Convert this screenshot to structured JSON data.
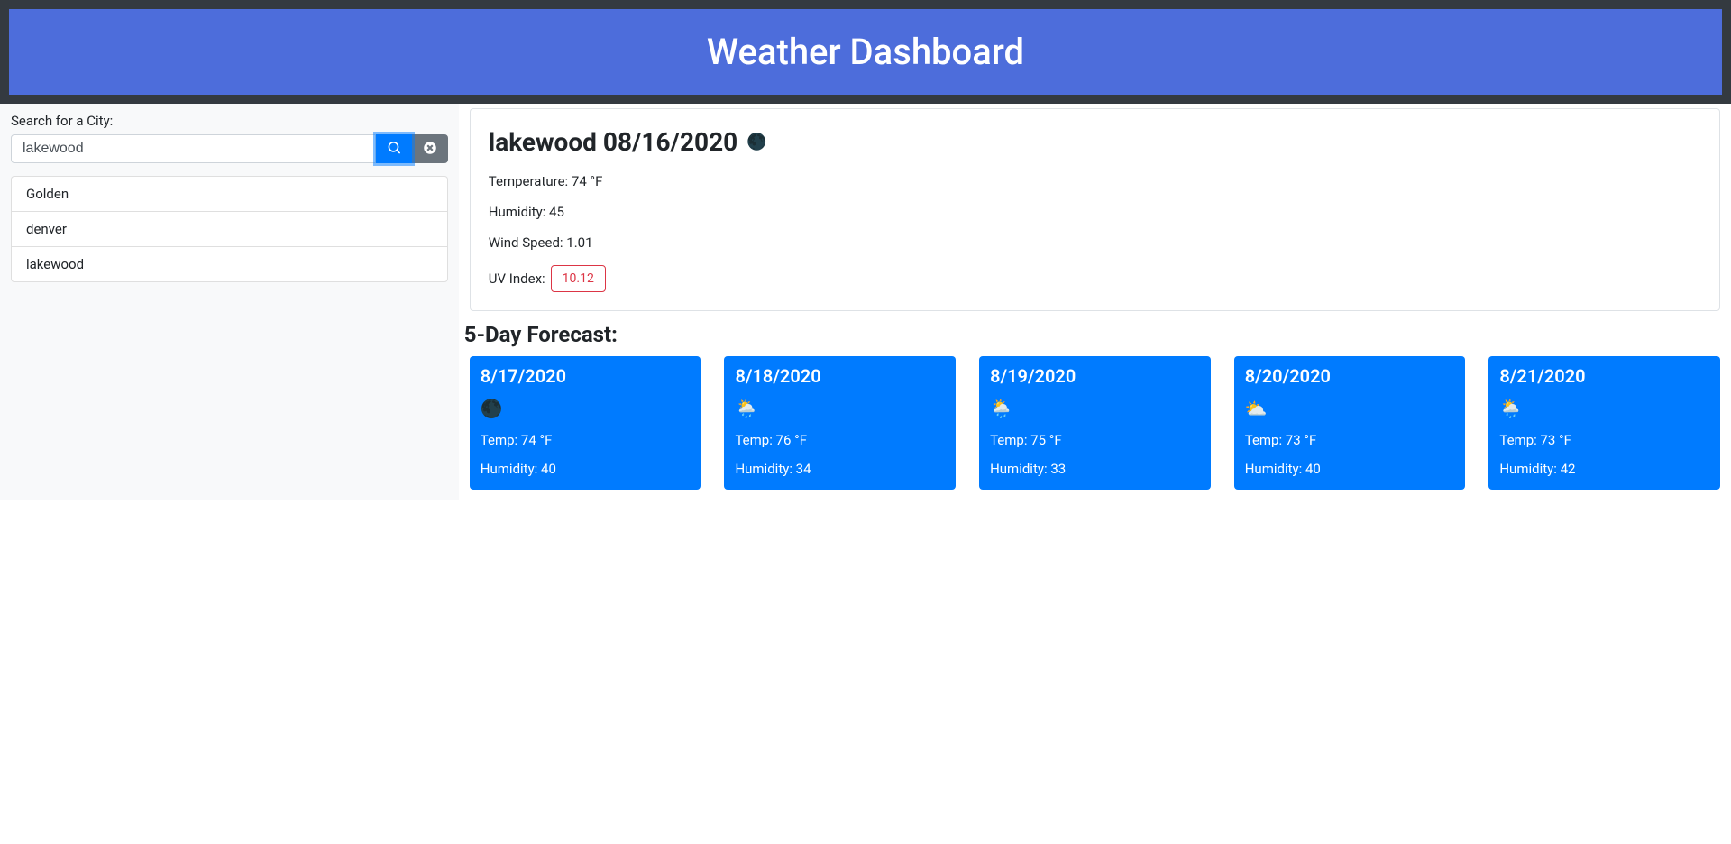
{
  "header": {
    "title": "Weather Dashboard"
  },
  "search": {
    "label": "Search for a City:",
    "value": "lakewood"
  },
  "history": [
    "Golden",
    "denver",
    "lakewood"
  ],
  "current": {
    "city": "lakewood",
    "date": "08/16/2020",
    "icon": "🌑",
    "temp_label": "Temperature: 74 °F",
    "humidity_label": "Humidity: 45",
    "wind_label": "Wind Speed: 1.01",
    "uv_label": "UV Index:",
    "uv_value": "10.12"
  },
  "forecast_title": "5-Day Forecast:",
  "forecast": [
    {
      "date": "8/17/2020",
      "icon": "🌑",
      "temp": "Temp: 74 °F",
      "humidity": "Humidity: 40"
    },
    {
      "date": "8/18/2020",
      "icon": "🌦️",
      "temp": "Temp: 76 °F",
      "humidity": "Humidity: 34"
    },
    {
      "date": "8/19/2020",
      "icon": "🌦️",
      "temp": "Temp: 75 °F",
      "humidity": "Humidity: 33"
    },
    {
      "date": "8/20/2020",
      "icon": "⛅",
      "temp": "Temp: 73 °F",
      "humidity": "Humidity: 40"
    },
    {
      "date": "8/21/2020",
      "icon": "🌦️",
      "temp": "Temp: 73 °F",
      "humidity": "Humidity: 42"
    }
  ]
}
